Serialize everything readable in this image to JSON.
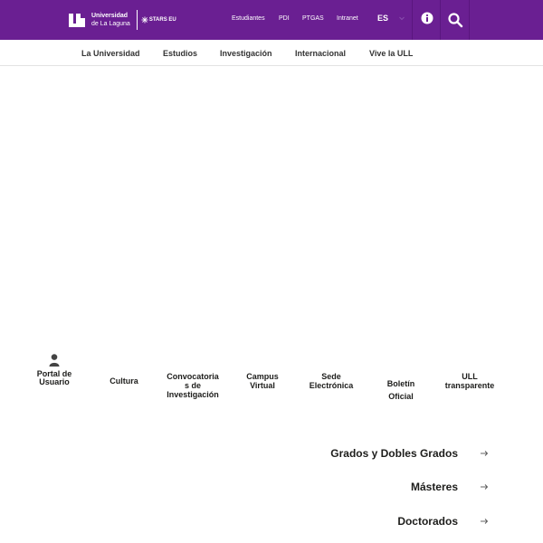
{
  "header": {
    "logo": {
      "line1": "Universidad",
      "line2": "de La Laguna",
      "partner": "STARS EU"
    },
    "links": [
      {
        "label": "Estudiantes"
      },
      {
        "label": "PDI"
      },
      {
        "label": "PTGAS"
      },
      {
        "label": "Intranet"
      }
    ],
    "language": "ES",
    "icons": {
      "language_caret": "chevron-down-icon",
      "info": "info-icon",
      "search": "search-icon"
    },
    "colors": {
      "background": "#6a1f92",
      "text": "#ffffff"
    }
  },
  "main_nav": {
    "items": [
      {
        "label": "La Universidad"
      },
      {
        "label": "Estudios"
      },
      {
        "label": "Investigación"
      },
      {
        "label": "Internacional"
      },
      {
        "label": "Vive la ULL"
      }
    ]
  },
  "quick_links": [
    {
      "lines": [
        "Portal de",
        "Usuario"
      ],
      "icon": "user-icon"
    },
    {
      "lines": [
        "Cultura"
      ]
    },
    {
      "lines": [
        "Convocatoria",
        "s de",
        "Investigación"
      ]
    },
    {
      "lines": [
        "Campus",
        "Virtual"
      ]
    },
    {
      "lines": [
        "Sede",
        "Electrónica"
      ]
    },
    {
      "lines": [
        "Boletín",
        "Oficial"
      ]
    },
    {
      "lines": [
        "ULL",
        "transparente"
      ]
    }
  ],
  "studies": [
    {
      "label": "Grados y Dobles Grados",
      "icon": "arrow-right-icon"
    },
    {
      "label": "Másteres",
      "icon": "arrow-right-icon"
    },
    {
      "label": "Doctorados",
      "icon": "arrow-right-icon"
    }
  ]
}
